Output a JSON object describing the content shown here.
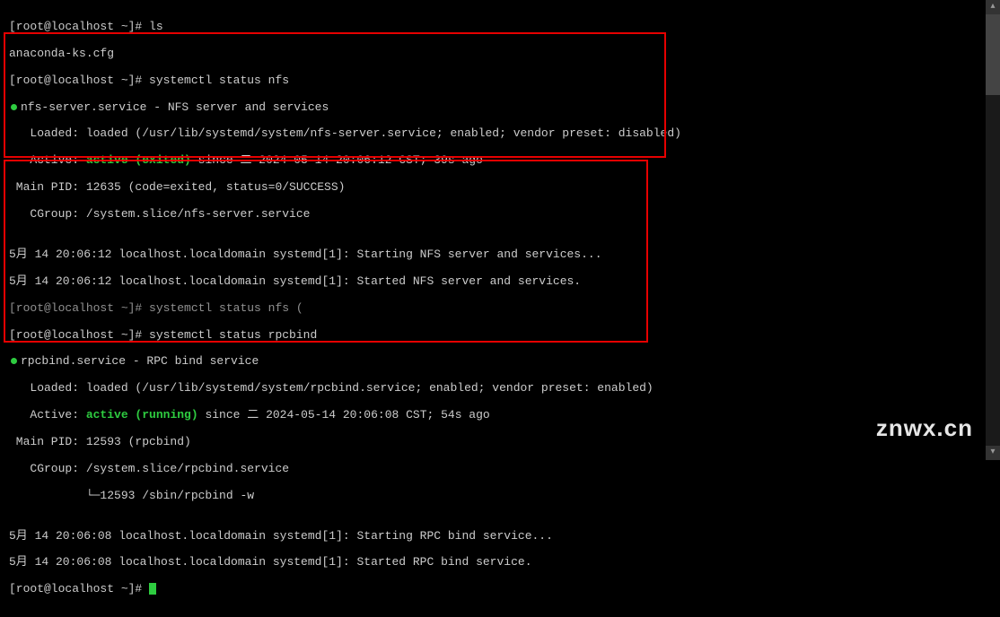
{
  "watermark": "znwx.cn",
  "lines": {
    "l1_prompt": "[root@localhost ~]# ",
    "l1_cmd": "ls",
    "l2": "anaconda-ks.cfg",
    "l3_prompt": "[root@localhost ~]# ",
    "l3_cmd": "systemctl status nfs",
    "l4a": "nfs-server.service - NFS server and services",
    "l5": "   Loaded: loaded (/usr/lib/systemd/system/nfs-server.service; enabled; vendor preset: disabled)",
    "l6a": "   Active: ",
    "l6b": "active (exited)",
    "l6c": " since 二 2024-05-14 20:06:12 CST; 39s ago",
    "l7": " Main PID: 12635 (code=exited, status=0/SUCCESS)",
    "l8": "   CGroup: /system.slice/nfs-server.service",
    "l9": "",
    "l10": "5月 14 20:06:12 localhost.localdomain systemd[1]: Starting NFS server and services...",
    "l11": "5月 14 20:06:12 localhost.localdomain systemd[1]: Started NFS server and services.",
    "l12": "[root@localhost ~]# systemctl status nfs (",
    "l13_prompt": "[root@localhost ~]# ",
    "l13_cmd": "systemctl status rpcbind",
    "l14a": "rpcbind.service - RPC bind service",
    "l15": "   Loaded: loaded (/usr/lib/systemd/system/rpcbind.service; enabled; vendor preset: enabled)",
    "l16a": "   Active: ",
    "l16b": "active (running)",
    "l16c": " since 二 2024-05-14 20:06:08 CST; 54s ago",
    "l17": " Main PID: 12593 (rpcbind)",
    "l18": "   CGroup: /system.slice/rpcbind.service",
    "l19": "           └─12593 /sbin/rpcbind -w",
    "l20": "",
    "l21": "5月 14 20:06:08 localhost.localdomain systemd[1]: Starting RPC bind service...",
    "l22": "5月 14 20:06:08 localhost.localdomain systemd[1]: Started RPC bind service.",
    "l23_prompt": "[root@localhost ~]# "
  }
}
